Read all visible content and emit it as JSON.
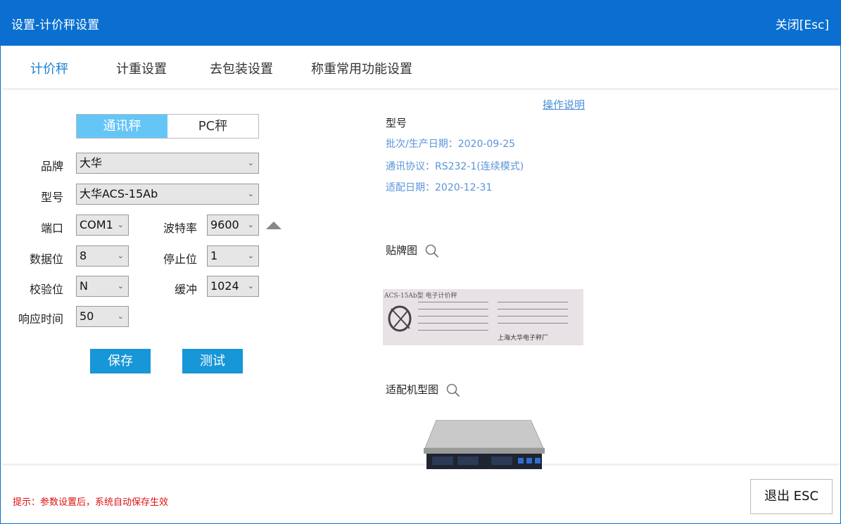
{
  "window": {
    "title": "设置-计价秤设置",
    "close_label": "关闭[Esc]"
  },
  "tabs": [
    {
      "label": "计价秤",
      "active": true
    },
    {
      "label": "计重设置",
      "active": false
    },
    {
      "label": "去包装设置",
      "active": false
    },
    {
      "label": "称重常用功能设置",
      "active": false
    }
  ],
  "scale_type": {
    "options": [
      "通讯秤",
      "PC秤"
    ],
    "selected": "通讯秤"
  },
  "form": {
    "brand": {
      "label": "品牌",
      "value": "大华"
    },
    "model": {
      "label": "型号",
      "value": "大华ACS-15Ab"
    },
    "port": {
      "label": "端口",
      "value": "COM1"
    },
    "baud": {
      "label": "波特率",
      "value": "9600"
    },
    "databits": {
      "label": "数据位",
      "value": "8"
    },
    "stopbits": {
      "label": "停止位",
      "value": "1"
    },
    "parity": {
      "label": "校验位",
      "value": "N"
    },
    "buffer": {
      "label": "缓冲",
      "value": "1024"
    },
    "response": {
      "label": "响应时间",
      "value": "50"
    }
  },
  "buttons": {
    "save": "保存",
    "test": "测试",
    "exit": "退出 ESC"
  },
  "info": {
    "help_link": "操作说明",
    "title": "型号",
    "batch": "批次/生产日期：2020-09-25",
    "protocol": "通讯协议：RS232-1(连续模式)",
    "adapt_date": "适配日期：2020-12-31",
    "nameplate_label": "贴牌图",
    "model_image_label": "适配机型图",
    "nameplate_model": "ACS-15Ab型 电子计价秤",
    "nameplate_maker": "上海大华电子秤厂"
  },
  "footer": {
    "note": "提示：参数设置后，系统自动保存生效"
  },
  "icons": {
    "search": "magnifier-icon",
    "expand": "triangle-up-icon",
    "dropdown": "chevron-down-icon"
  },
  "colors": {
    "titlebar": "#0a6fd0",
    "accent": "#1a7fd4",
    "button": "#1796d8",
    "segment_on": "#64c6f7",
    "hint": "#dd1111"
  }
}
